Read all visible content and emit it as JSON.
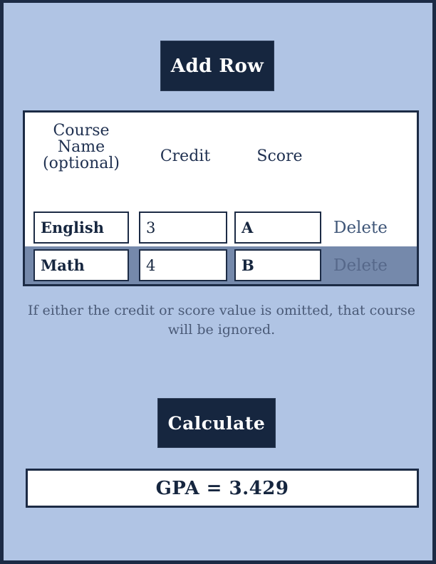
{
  "app": {
    "background_color": "#b0c4e4",
    "accent_color": "#16263f",
    "selected_row_color": "#7589ab"
  },
  "toolbar": {
    "add_row_label": "Add Row"
  },
  "table": {
    "headers": {
      "course_name": "Course Name (optional)",
      "credit": "Credit",
      "score": "Score",
      "delete": ""
    },
    "rows": [
      {
        "course_name": "English",
        "credit": "3",
        "score": "A",
        "delete_label": "Delete",
        "selected": false
      },
      {
        "course_name": "Math",
        "credit": "4",
        "score": "B",
        "delete_label": "Delete",
        "selected": true
      }
    ],
    "placeholders": {
      "course_name": "",
      "credit": "",
      "score": ""
    }
  },
  "note": {
    "text": "If either the credit or score value is omitted, that course will be ignored."
  },
  "actions": {
    "calculate_label": "Calculate"
  },
  "result": {
    "gpa_text": "GPA = 3.429",
    "gpa_value": "3.429"
  }
}
